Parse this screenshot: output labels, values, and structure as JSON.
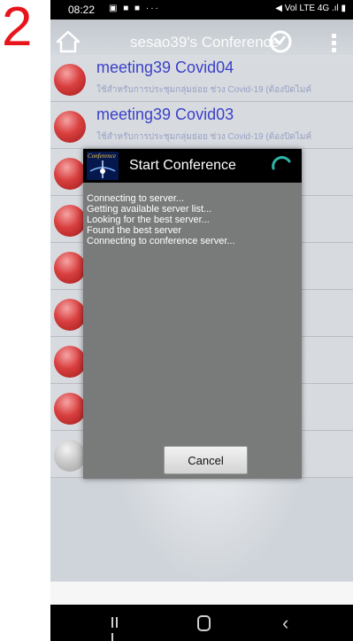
{
  "step_number": "2",
  "status_bar": {
    "time": "08:22",
    "left_icons": "▣ ■ ■ ···",
    "right_icons": "◀ Vol LTE 4G .ıl ▮"
  },
  "app_bar": {
    "title": "sesao39's Conference",
    "home_icon": "home-icon",
    "refresh_icon": "refresh-icon",
    "menu_icon": "overflow-menu-icon"
  },
  "meetings": [
    {
      "name": "meeting39 Covid04",
      "desc": "ใช้สำหรับการประชุมกลุ่มย่อย ช่วง Covid-19 (ต้องปิดไมค์",
      "color": "red"
    },
    {
      "name": "meeting39 Covid03",
      "desc": "ใช้สำหรับการประชุมกลุ่มย่อย ช่วง Covid-19 (ต้องปิดไมค์",
      "color": "red"
    },
    {
      "name": "",
      "desc": "",
      "color": "red"
    },
    {
      "name": "",
      "desc": "",
      "color": "red"
    },
    {
      "name": "",
      "desc": "",
      "color": "red"
    },
    {
      "name": "",
      "desc": "",
      "color": "red"
    },
    {
      "name": "",
      "desc": "",
      "color": "red"
    },
    {
      "name": "",
      "desc": "",
      "color": "red"
    },
    {
      "name": "",
      "desc": "",
      "color": "grey"
    }
  ],
  "dialog": {
    "logo_text": "Conference",
    "title": "Start Conference",
    "log": [
      "Connecting to server...",
      "Getting available server list...",
      "Looking for the best server...",
      "Found the best server",
      "Connecting to conference server..."
    ],
    "cancel_label": "Cancel"
  },
  "nav_bar": {
    "recents_icon": "recents-icon",
    "home_icon": "home-circle-icon",
    "back_icon": "back-icon"
  },
  "colors": {
    "step_number": "#e8141b",
    "meeting_title": "#3b41c8",
    "dialog_bg": "#797a7a"
  }
}
